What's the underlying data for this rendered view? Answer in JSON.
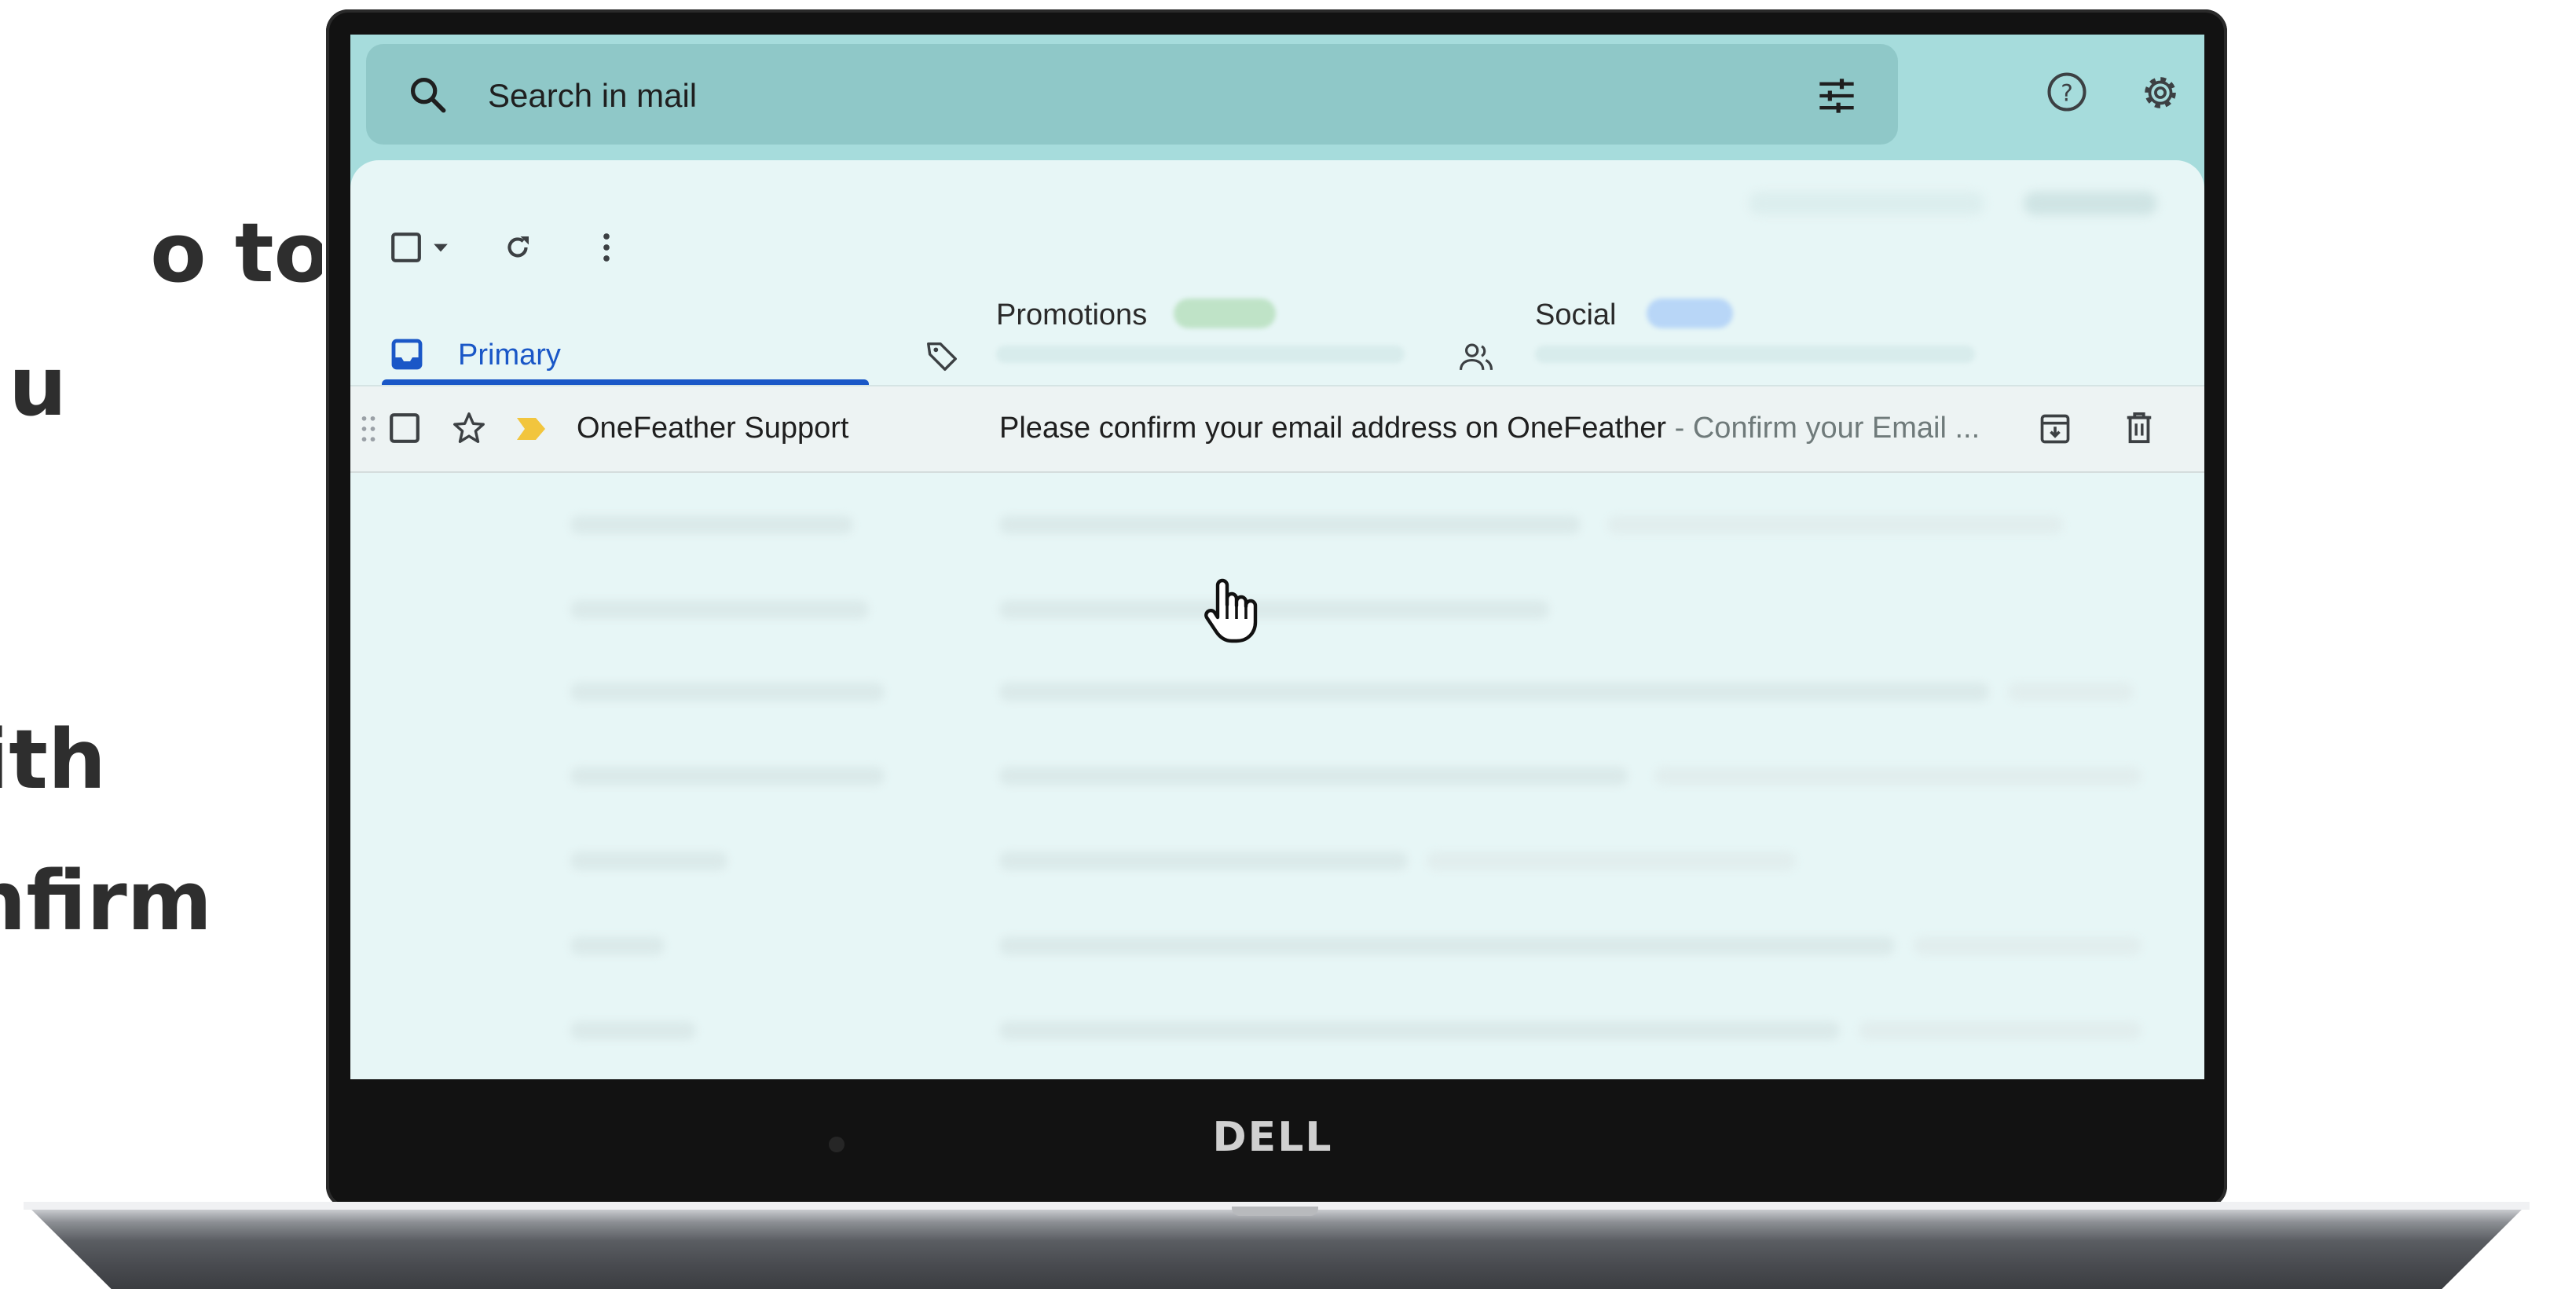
{
  "slide_text": {
    "lines": [
      "o to",
      "u",
      "ith",
      "nfirm"
    ]
  },
  "search": {
    "placeholder": "Search in mail",
    "icon": "search-icon",
    "filter_icon": "tune-icon"
  },
  "header_icons": [
    "help-icon",
    "settings-icon"
  ],
  "toolbar": {
    "icons": [
      "select-checkbox-icon",
      "chevron-down-icon",
      "refresh-icon",
      "more-vert-icon"
    ]
  },
  "tabs": [
    {
      "label": "Primary",
      "icon": "inbox-icon",
      "selected": true
    },
    {
      "label": "Promotions",
      "icon": "tag-icon",
      "chip_color": "#bfe3c7"
    },
    {
      "label": "Social",
      "icon": "people-icon",
      "chip_color": "#b8d6f7"
    }
  ],
  "email": {
    "sender": "OneFeather Support",
    "subject": "Please confirm your email address on OneFeather",
    "snippet": " - Confirm your Email ...",
    "important_color": "#f2c53d"
  },
  "laptop": {
    "brand": "DELL"
  },
  "colors": {
    "accent": "#1a57c7",
    "screen_bg": "#a6dcdc",
    "search_bg": "#8fc8c8",
    "panel_bg": "#e7f6f6"
  }
}
